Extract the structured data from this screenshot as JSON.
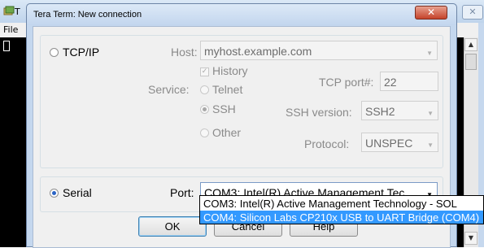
{
  "background_window": {
    "title_char": "T",
    "menu": [
      "File"
    ],
    "close_label": "✕"
  },
  "dialog": {
    "title": "Tera Term: New connection",
    "close_label": "✕",
    "tcpip": {
      "label": "TCP/IP",
      "selected": false,
      "host_label": "Host:",
      "host_value": "myhost.example.com",
      "history_label": "History",
      "history_checked": true,
      "service_label": "Service:",
      "services": [
        {
          "label": "Telnet",
          "selected": false
        },
        {
          "label": "SSH",
          "selected": true
        },
        {
          "label": "Other",
          "selected": false
        }
      ],
      "tcp_port_label": "TCP port#:",
      "tcp_port_value": "22",
      "ssh_version_label": "SSH version:",
      "ssh_version_value": "SSH2",
      "protocol_label": "Protocol:",
      "protocol_value": "UNSPEC"
    },
    "serial": {
      "label": "Serial",
      "selected": true,
      "port_label": "Port:",
      "port_value": "COM3: Intel(R) Active Management Tec",
      "port_options": [
        {
          "label": "COM3: Intel(R) Active Management Technology - SOL",
          "highlighted": false
        },
        {
          "label": "COM4: Silicon Labs CP210x USB to UART Bridge (COM4)",
          "highlighted": true
        }
      ]
    },
    "buttons": {
      "ok": "OK",
      "cancel": "Cancel",
      "help": "Help"
    }
  },
  "colors": {
    "selection_highlight": "#3399ff",
    "dialog_close_red": "#c5432a",
    "terminal_bg": "#000000"
  }
}
